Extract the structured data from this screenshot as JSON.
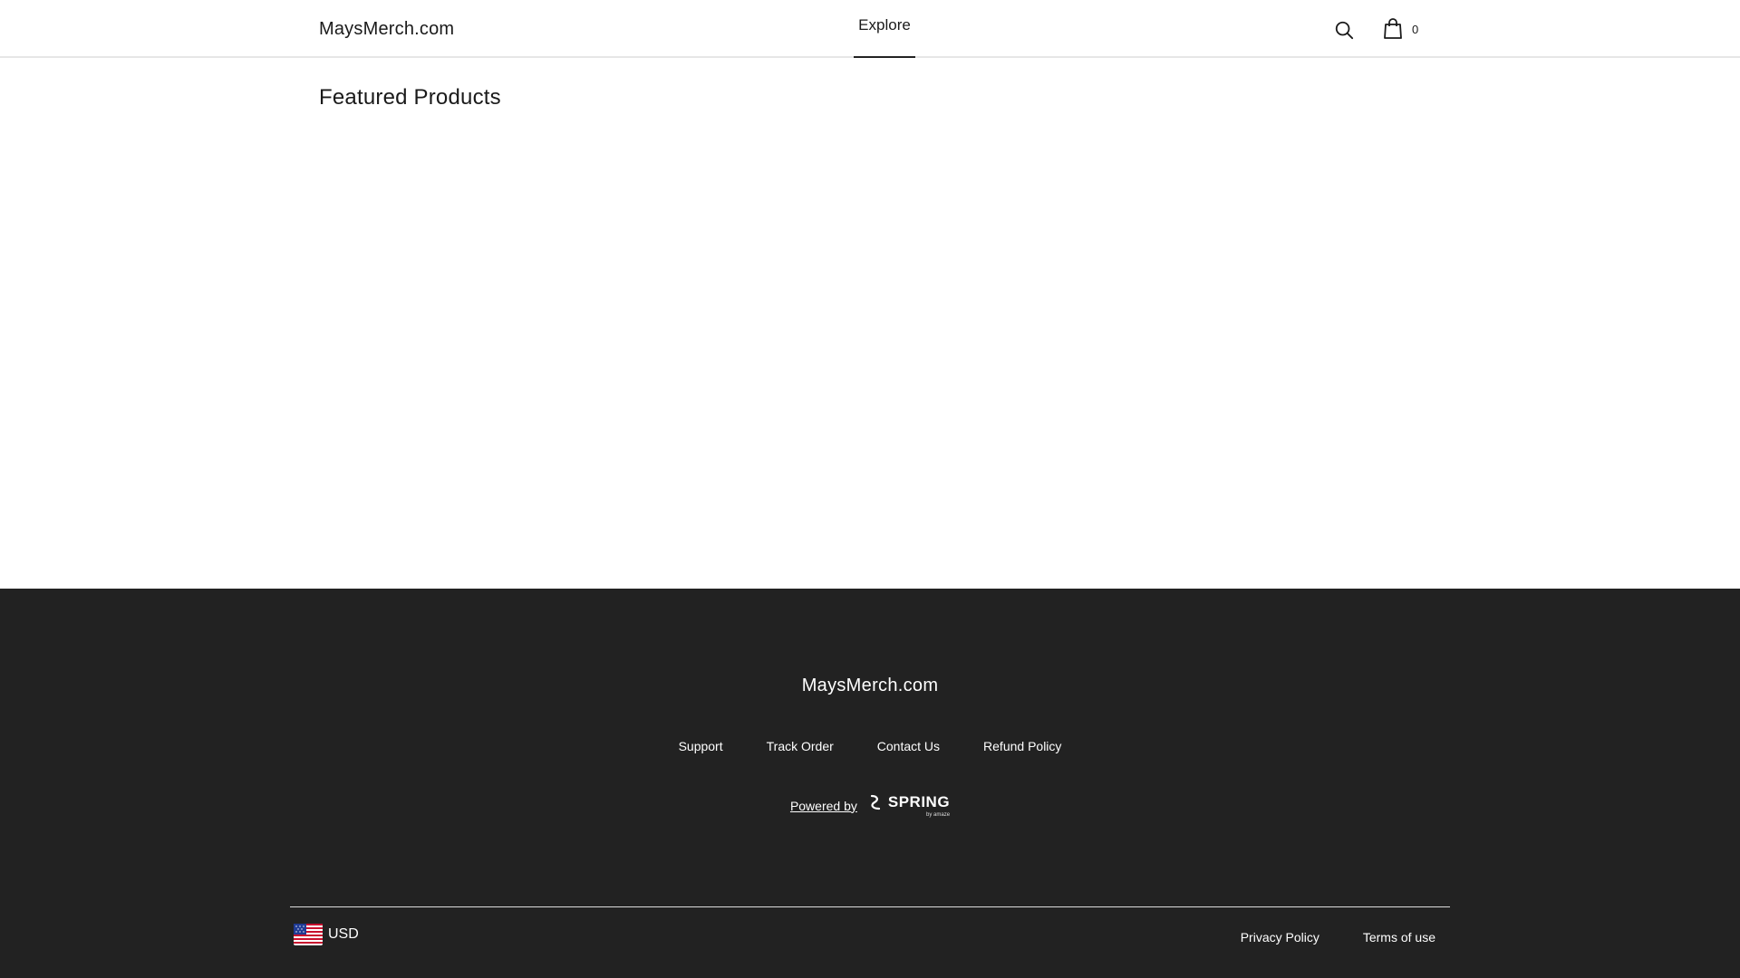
{
  "header": {
    "logo": "MaysMerch.com",
    "nav": {
      "explore_label": "Explore"
    },
    "cart_count": "0"
  },
  "main": {
    "section_title": "Featured Products"
  },
  "footer": {
    "brand": "MaysMerch.com",
    "links": [
      "Support",
      "Track Order",
      "Contact Us",
      "Refund Policy"
    ],
    "powered_by_label": "Powered by",
    "powered_by_brand": "SPRING",
    "powered_by_sub": "by amaze",
    "currency": {
      "code": "USD",
      "flag": "us-flag-icon"
    },
    "legal": {
      "privacy": "Privacy Policy",
      "terms": "Terms of use"
    }
  },
  "colors": {
    "footer_bg": "#222222",
    "text_dark": "#1a1a1a",
    "header_border": "#e6e6e6"
  }
}
